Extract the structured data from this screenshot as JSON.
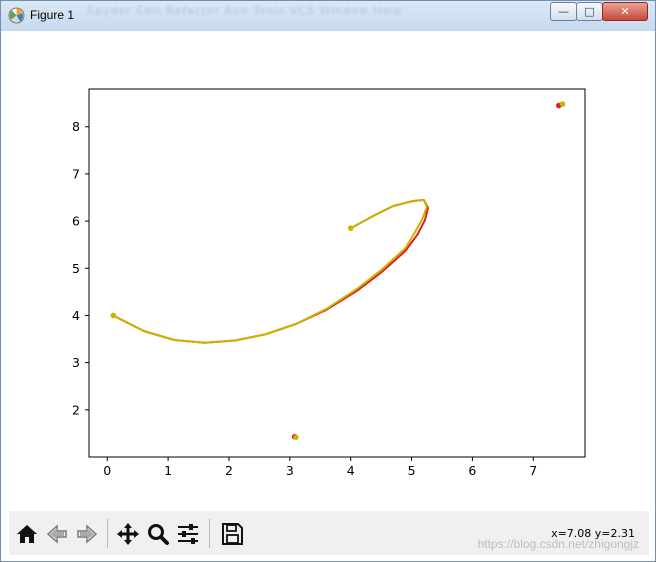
{
  "window": {
    "title": "Figure 1",
    "menu_blur": "Spyder  Edit  Refactor  Run  Tools  VCS  Window  Help",
    "min_glyph": "—",
    "max_glyph": "□",
    "close_glyph": "✕"
  },
  "toolbar": {
    "buttons": [
      {
        "name": "home-icon"
      },
      {
        "name": "back-arrow-icon"
      },
      {
        "name": "forward-arrow-icon"
      },
      {
        "name": "pan-icon"
      },
      {
        "name": "zoom-icon"
      },
      {
        "name": "configure-subplots-icon"
      },
      {
        "name": "save-icon"
      }
    ],
    "coords": "x=7.08 y=2.31",
    "watermark": "https://blog.csdn.net/zhigongjz"
  },
  "chart_data": {
    "type": "line",
    "xlim": [
      -0.3,
      7.85
    ],
    "ylim": [
      1.0,
      8.8
    ],
    "xticks": [
      0,
      1,
      2,
      3,
      4,
      5,
      6,
      7
    ],
    "yticks": [
      2,
      3,
      4,
      5,
      6,
      7,
      8
    ],
    "grid": false,
    "series": [
      {
        "color": "#e41a1c",
        "x": [
          0.1,
          0.6,
          1.1,
          1.6,
          2.1,
          2.6,
          3.1,
          3.6,
          4.1,
          4.5,
          4.9,
          5.1,
          5.22,
          5.27,
          5.2,
          5.0,
          4.7,
          4.4,
          4.0
        ],
        "y": [
          4.0,
          3.67,
          3.48,
          3.42,
          3.47,
          3.6,
          3.82,
          4.12,
          4.52,
          4.91,
          5.37,
          5.72,
          6.02,
          6.28,
          6.45,
          6.42,
          6.32,
          6.13,
          5.85
        ],
        "points": [
          [
            7.42,
            8.45
          ],
          [
            3.08,
            1.43
          ]
        ]
      },
      {
        "color": "#c8b400",
        "x": [
          0.1,
          0.6,
          1.1,
          1.6,
          2.1,
          2.6,
          3.1,
          3.6,
          4.1,
          4.5,
          4.9,
          5.05,
          5.18,
          5.25,
          5.2,
          5.0,
          4.7,
          4.4,
          4.0
        ],
        "y": [
          4.0,
          3.67,
          3.48,
          3.42,
          3.47,
          3.6,
          3.82,
          4.14,
          4.56,
          4.96,
          5.43,
          5.75,
          6.05,
          6.3,
          6.45,
          6.42,
          6.32,
          6.13,
          5.85
        ],
        "points": [
          [
            7.48,
            8.48
          ],
          [
            3.1,
            1.42
          ],
          [
            0.1,
            4.0
          ],
          [
            4.0,
            5.85
          ]
        ]
      }
    ]
  }
}
